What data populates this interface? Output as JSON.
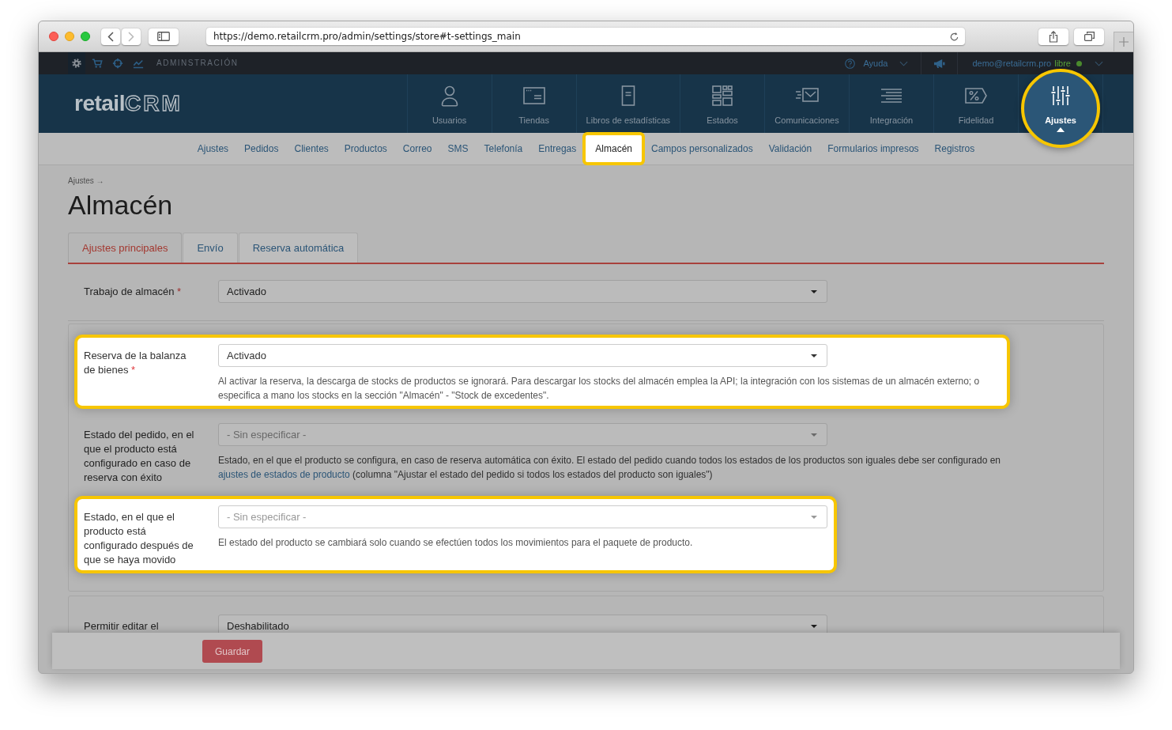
{
  "browser": {
    "url": "https://demo.retailcrm.pro/admin/settings/store#t-settings_main",
    "back": {
      "disabled": false
    },
    "forward": {
      "disabled": true
    }
  },
  "admin_bar": {
    "tools": [
      {
        "selected": true
      },
      {
        "selected": false
      },
      {
        "selected": false
      },
      {
        "selected": false
      }
    ],
    "section": "ADMINSTRACIÓN",
    "help": "Ayuda",
    "user": "demo@retailcrm.pro",
    "plan": "libre"
  },
  "header": {
    "logo": {
      "word": "retail",
      "mark": "CRM"
    },
    "nav": [
      {
        "label": "Usuarios",
        "selected": false,
        "highlighted": false
      },
      {
        "label": "Tiendas",
        "selected": false,
        "highlighted": false
      },
      {
        "label": "Libros de estadísticas",
        "selected": false,
        "highlighted": false
      },
      {
        "label": "Estados",
        "selected": false,
        "highlighted": false
      },
      {
        "label": "Comunicaciones",
        "selected": false,
        "highlighted": false
      },
      {
        "label": "Integración",
        "selected": false,
        "highlighted": false
      },
      {
        "label": "Fidelidad",
        "selected": false,
        "highlighted": false
      },
      {
        "label": "Ajustes",
        "selected": true,
        "highlighted": true
      }
    ]
  },
  "sub_nav": [
    {
      "label": "Ajustes",
      "selected": false,
      "highlighted": false
    },
    {
      "label": "Pedidos",
      "selected": false,
      "highlighted": false
    },
    {
      "label": "Clientes",
      "selected": false,
      "highlighted": false
    },
    {
      "label": "Productos",
      "selected": false,
      "highlighted": false
    },
    {
      "label": "Correo",
      "selected": false,
      "highlighted": false
    },
    {
      "label": "SMS",
      "selected": false,
      "highlighted": false
    },
    {
      "label": "Telefonía",
      "selected": false,
      "highlighted": false
    },
    {
      "label": "Entregas",
      "selected": false,
      "highlighted": false
    },
    {
      "label": "Almacén",
      "selected": true,
      "highlighted": true
    },
    {
      "label": "Campos personalizados",
      "selected": false,
      "highlighted": false
    },
    {
      "label": "Validación",
      "selected": false,
      "highlighted": false
    },
    {
      "label": "Formularios impresos",
      "selected": false,
      "highlighted": false
    },
    {
      "label": "Registros",
      "selected": false,
      "highlighted": false
    }
  ],
  "breadcrumb": "Ajustes →",
  "title": "Almacén",
  "tabs": [
    {
      "label": "Ajustes principales",
      "selected": true
    },
    {
      "label": "Envío",
      "selected": false
    },
    {
      "label": "Reserva automática",
      "selected": false
    }
  ],
  "sections": [
    {
      "fields": [
        {
          "label": "Trabajo de almacén",
          "required_mark": "*",
          "value": "Activado",
          "highlighted": false
        }
      ]
    },
    {
      "fields": [
        {
          "label": "Reserva de la balanza de bienes",
          "required_mark": "*",
          "value": "Activado",
          "help": [
            {
              "kind": "text",
              "text": "Al activar la reserva, la descarga de stocks de productos se ignorará. Para descargar los stocks del almacén emplea la API; la integración con los sistemas de un almacén externo; o especifica a mano los stocks en la sección \"Almacén\" - \"Stock de excedentes\"."
            }
          ],
          "highlighted": true
        },
        {
          "label": "Estado del pedido, en el que el producto está configurado en caso de reserva con éxito",
          "placeholder": "- Sin especificar -",
          "help": [
            {
              "kind": "text",
              "text": "Estado, en el que el producto se configura, en caso de reserva automática con éxito. El estado del pedido cuando todos los estados de los productos son iguales debe ser configurado en "
            },
            {
              "kind": "link",
              "text": "ajustes de estados de producto"
            },
            {
              "kind": "text",
              "text": " (columna \"Ajustar el estado del pedido si todos los estados del producto son iguales\")"
            }
          ],
          "highlighted": false
        },
        {
          "label": "Estado, en el que el producto está configurado después de que se haya movido",
          "placeholder": "- Sin especificar -",
          "help": [
            {
              "kind": "text",
              "text": "El estado del producto se cambiará solo cuando se efectúen todos los movimientos para el paquete de producto."
            }
          ],
          "highlighted": true
        }
      ]
    },
    {
      "fields": [
        {
          "label": "Permitir editar el",
          "value": "Deshabilitado",
          "highlighted": false
        }
      ]
    }
  ],
  "footer": {
    "save": "Guardar"
  }
}
